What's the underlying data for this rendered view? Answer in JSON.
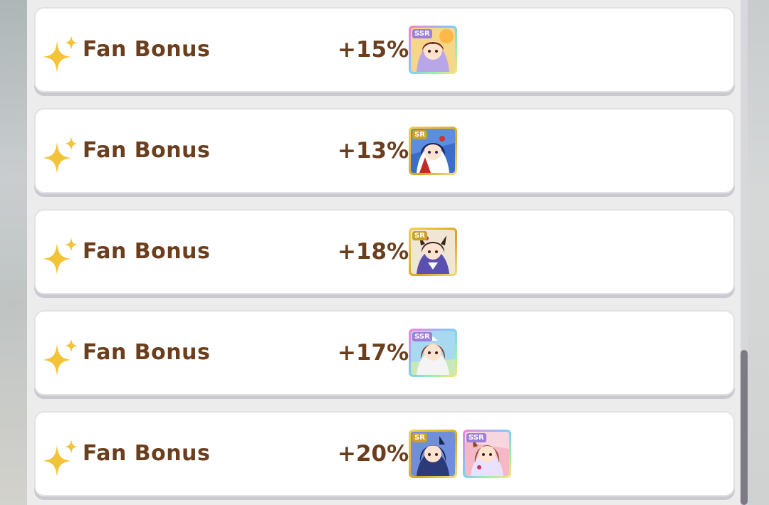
{
  "bonus_rows": [
    {
      "label": "Fan Bonus",
      "value": "+15%",
      "cards": [
        {
          "rarity": "SSR",
          "icon": "character-card-portrait-icon",
          "bg": "#f7c56a",
          "hair": "#7a2e22"
        }
      ]
    },
    {
      "label": "Fan Bonus",
      "value": "+13%",
      "cards": [
        {
          "rarity": "SR",
          "icon": "character-card-portrait-icon",
          "bg": "#3a6fc6",
          "hair": "#1c2258"
        }
      ]
    },
    {
      "label": "Fan Bonus",
      "value": "+18%",
      "cards": [
        {
          "rarity": "SR",
          "icon": "character-card-portrait-icon",
          "bg": "#efe6d6",
          "hair": "#3a2418"
        }
      ]
    },
    {
      "label": "Fan Bonus",
      "value": "+17%",
      "cards": [
        {
          "rarity": "SSR",
          "icon": "character-card-portrait-icon",
          "bg": "#a8d9f0",
          "hair": "#7a3c22"
        }
      ]
    },
    {
      "label": "Fan Bonus",
      "value": "+20%",
      "cards": [
        {
          "rarity": "SR",
          "icon": "character-card-portrait-icon",
          "bg": "#6f8fd8",
          "hair": "#1e2450"
        },
        {
          "rarity": "SSR",
          "icon": "character-card-portrait-icon",
          "bg": "#f3b9c7",
          "hair": "#8a4a2a"
        }
      ]
    }
  ],
  "colors": {
    "text": "#6b3f1e",
    "sparkle": "#f3c43a",
    "row_bg": "#ffffff",
    "scroll_thumb": "#7d7a86"
  },
  "scroll_position": 0.9
}
